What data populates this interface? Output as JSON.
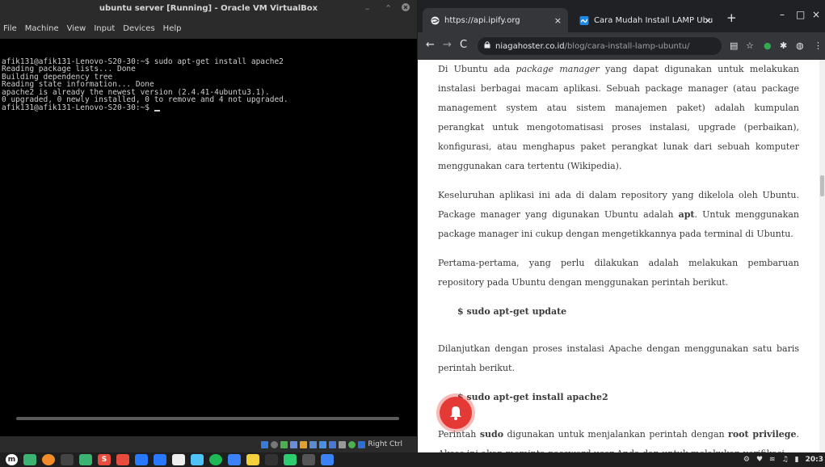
{
  "vbox": {
    "title": "ubuntu server [Running] - Oracle VM VirtualBox",
    "menu": [
      "File",
      "Machine",
      "View",
      "Input",
      "Devices",
      "Help"
    ],
    "terminal_lines": [
      "afik131@afik131-Lenovo-S20-30:~$ sudo apt-get install apache2",
      "Reading package lists... Done",
      "Building dependency tree",
      "Reading state information... Done",
      "apache2 is already the newest version (2.4.41-4ubuntu3.1).",
      "0 upgraded, 0 newly installed, 0 to remove and 4 not upgraded."
    ],
    "prompt": "afik131@afik131-Lenovo-S20-30:~$ ",
    "host_key": "Right Ctrl"
  },
  "browser": {
    "tabs": [
      {
        "label": "https://api.ipify.org",
        "active": true
      },
      {
        "label": "Cara Mudah Install LAMP Ubu",
        "active": false
      }
    ],
    "url_host": "niagahoster.co.id",
    "url_path": "/blog/cara-install-lamp-ubuntu/",
    "article": {
      "p1_a": "Di Ubuntu ada ",
      "p1_em": "package manager",
      "p1_b": " yang dapat digunakan untuk melakukan instalasi berbagai macam aplikasi. Sebuah package manager (atau package management system atau sistem manajemen paket) adalah kumpulan perangkat untuk mengotomatisasi proses instalasi, upgrade (perbaikan), konfigurasi, atau menghapus paket perangkat lunak dari sebuah komputer menggunakan cara tertentu (Wikipedia).",
      "p2_a": "Keseluruhan aplikasi ini ada di dalam repository yang dikelola oleh Ubuntu. Package manager yang digunakan Ubuntu adalah ",
      "p2_b": "apt",
      "p2_c": ". Untuk menggunakan package manager ini cukup dengan mengetikkannya pada terminal di Ubuntu.",
      "p3": "Pertama-pertama, yang perlu dilakukan adalah melakukan pembaruan repository pada Ubuntu dengan menggunakan perintah berikut.",
      "cmd1": "$ sudo apt-get update",
      "p4": "Dilanjutkan dengan proses instalasi Apache dengan menggunakan satu baris perintah berikut.",
      "cmd2": "$ sudo apt-get install apache2",
      "p5_a": "Perintah ",
      "p5_b": "sudo",
      "p5_c": " digunakan untuk menjalankan perintah dengan ",
      "p5_d": "root privilege",
      "p5_e": ". Akses ini akan meminta password user Anda dan untuk melakukan verifikasi."
    }
  },
  "taskbar": {
    "clock": "20:3"
  },
  "colors": {
    "accent_red": "#e53935",
    "chrome_dark": "#202124",
    "chrome_toolbar": "#35363a"
  }
}
